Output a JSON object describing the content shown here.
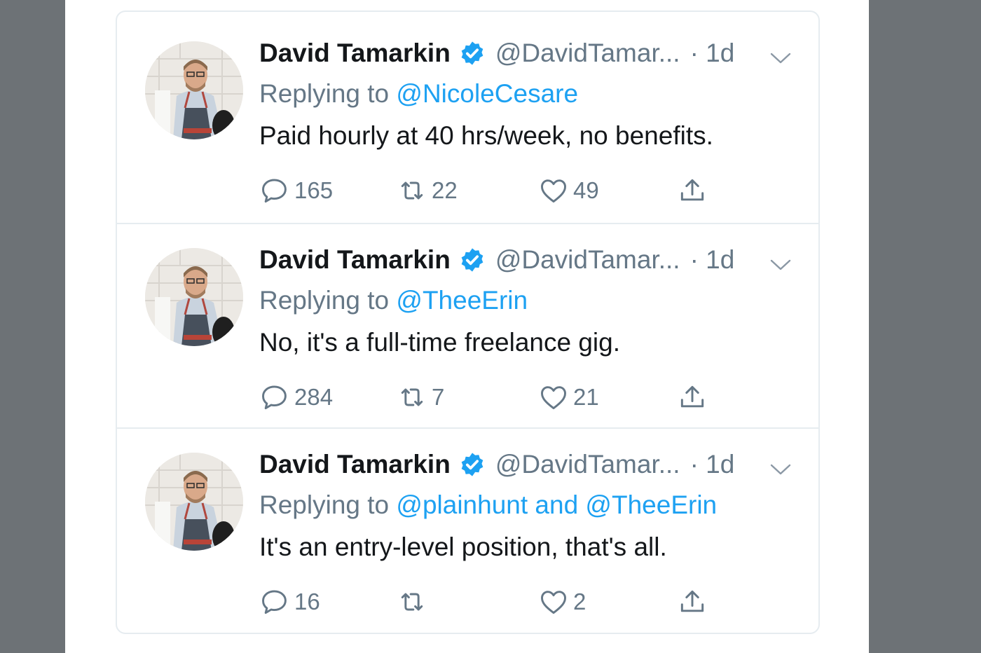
{
  "tweets": [
    {
      "name": "David Tamarkin",
      "handle": "@DavidTamar...",
      "time": "· 1d",
      "replying_prefix": "Replying to",
      "replying_to": "@NicoleCesare",
      "text": "Paid hourly at 40 hrs/week, no benefits.",
      "replies": "165",
      "retweets": "22",
      "likes": "49"
    },
    {
      "name": "David Tamarkin",
      "handle": "@DavidTamar...",
      "time": "· 1d",
      "replying_prefix": "Replying to",
      "replying_to": "@TheeErin",
      "text": "No, it's a full-time freelance gig.",
      "replies": "284",
      "retweets": "7",
      "likes": "21"
    },
    {
      "name": "David Tamarkin",
      "handle": "@DavidTamar...",
      "time": "· 1d",
      "replying_prefix": "Replying to",
      "replying_to": "@plainhunt and @TheeErin",
      "text": "It's an entry-level position, that's all.",
      "replies": "16",
      "retweets": "",
      "likes": "2"
    }
  ],
  "icons": {
    "verified": "verified-badge-icon",
    "caret": "chevron-down-icon",
    "reply": "reply-bubble-icon",
    "retweet": "retweet-icon",
    "like": "heart-icon",
    "share": "share-upload-icon"
  },
  "colors": {
    "accent": "#1da1f2",
    "secondary_text": "#657786",
    "primary_text": "#14171a",
    "border": "#e6ecf0",
    "backdrop": "#6d7276"
  }
}
